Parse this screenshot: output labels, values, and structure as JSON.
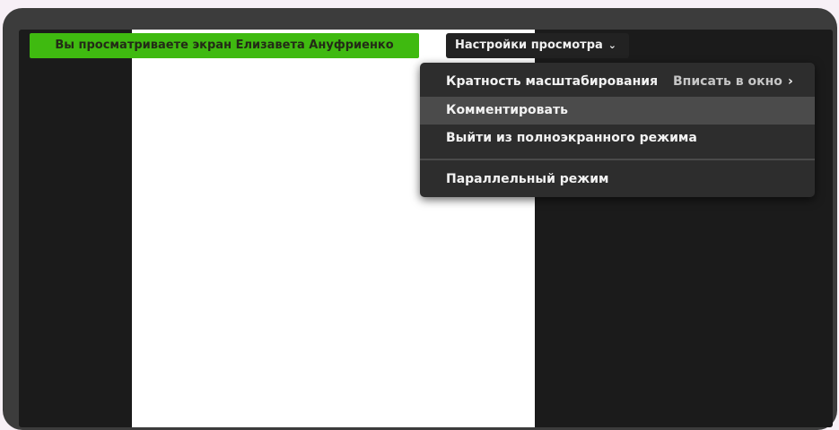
{
  "banner": {
    "text": "Вы просматриваете экран Елизавета Ануфриенко"
  },
  "view_settings": {
    "label": "Настройки просмотра",
    "chevron_icon": "chevron-down-icon"
  },
  "menu": {
    "items": [
      {
        "label": "Кратность масштабирования",
        "value": "Вписать в окно",
        "submenu_icon": "chevron-right-icon"
      },
      {
        "label": "Комментировать",
        "highlighted": true
      },
      {
        "label": "Выйти из полноэкранного режима"
      },
      {
        "label": "Параллельный режим"
      }
    ]
  },
  "colors": {
    "banner": "#3fba10",
    "menu_bg": "#2d2d2d",
    "highlight": "#4b4b4b",
    "screen_bg": "#1b1b1b"
  }
}
